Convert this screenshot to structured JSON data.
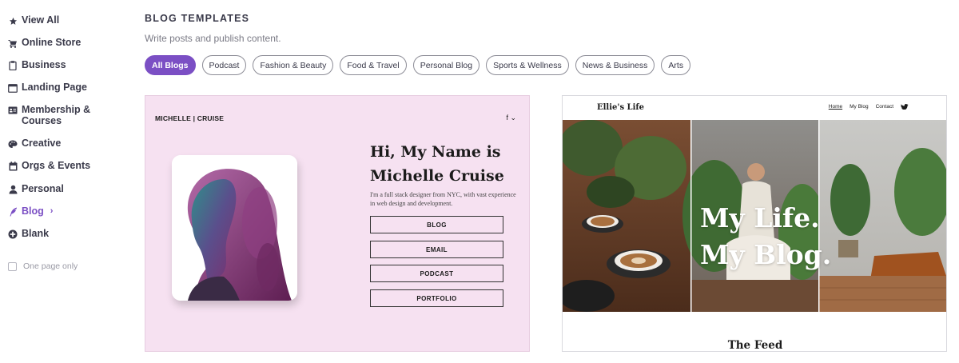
{
  "sidebar": {
    "items": [
      {
        "label": "View All",
        "icon": "star-icon"
      },
      {
        "label": "Online Store",
        "icon": "cart-icon"
      },
      {
        "label": "Business",
        "icon": "clipboard-icon"
      },
      {
        "label": "Landing Page",
        "icon": "window-icon"
      },
      {
        "label": "Membership &",
        "label2": "Courses",
        "icon": "id-card-icon"
      },
      {
        "label": "Creative",
        "icon": "palette-icon"
      },
      {
        "label": "Orgs & Events",
        "icon": "calendar-icon"
      },
      {
        "label": "Personal",
        "icon": "person-icon"
      },
      {
        "label": "Blog",
        "icon": "quill-icon",
        "active": true
      },
      {
        "label": "Blank",
        "icon": "plus-circle-icon"
      }
    ],
    "one_page_only": "One page only",
    "active_color": "#7b4fc4"
  },
  "main": {
    "heading": "BLOG TEMPLATES",
    "subheading": "Write posts and publish content.",
    "filters": [
      "All Blogs",
      "Podcast",
      "Fashion & Beauty",
      "Food & Travel",
      "Personal Blog",
      "Sports & Wellness",
      "News & Business",
      "Arts"
    ],
    "active_filter": "All Blogs"
  },
  "templates": {
    "michelle": {
      "brand": "MICHELLE | CRUISE",
      "social": "f ⌄",
      "title_line1": "Hi, My Name is",
      "title_line2": "Michelle Cruise",
      "description": "I'm a full stack designer from NYC, with vast experience in web design and development.",
      "buttons": [
        "BLOG",
        "EMAIL",
        "PODCAST",
        "PORTFOLIO"
      ],
      "background": "#f6e1f1"
    },
    "ellie": {
      "brand": "Ellie's Life",
      "nav": [
        "Home",
        "My Blog",
        "Contact"
      ],
      "social": "🐦 ⌄",
      "hero_line1": "My Life.",
      "hero_line2": "My Blog.",
      "feed_title": "The Feed"
    }
  }
}
